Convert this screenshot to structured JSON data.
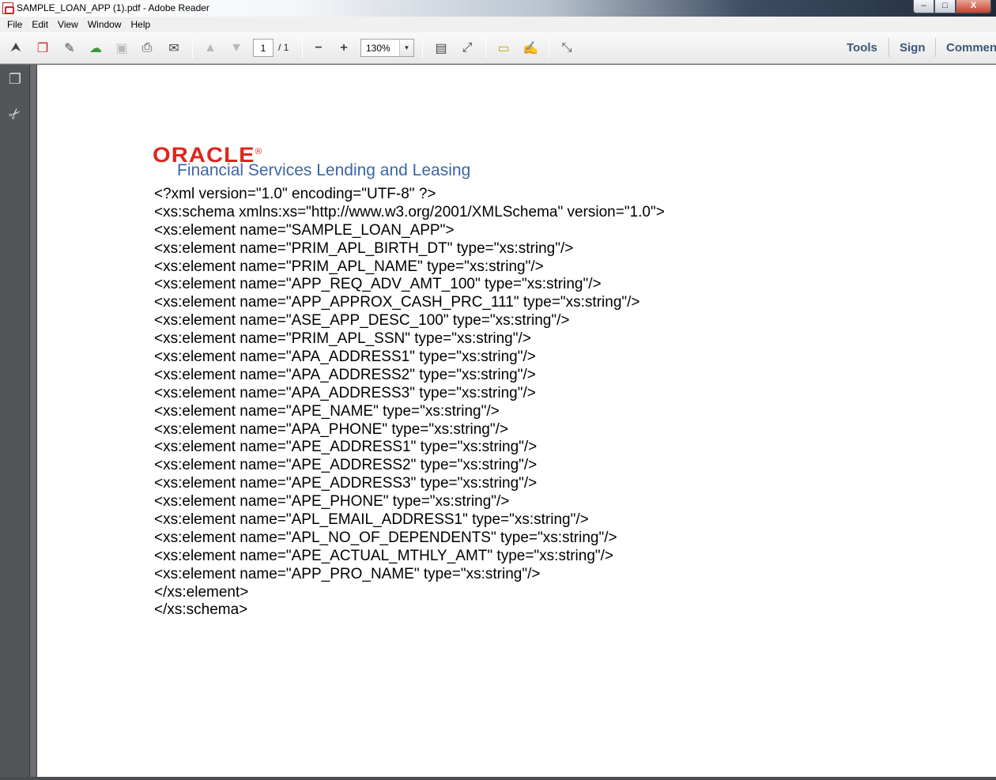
{
  "window": {
    "title": "SAMPLE_LOAN_APP (1).pdf - Adobe Reader",
    "controls": {
      "minimize": "–",
      "maximize": "□",
      "close": "X"
    }
  },
  "menubar": {
    "items": [
      "File",
      "Edit",
      "View",
      "Window",
      "Help"
    ]
  },
  "toolbar": {
    "page_current": "1",
    "page_total": "/ 1",
    "zoom": "130%",
    "zoom_arrow": "▼",
    "icons": {
      "create": "⮝",
      "open": "❐",
      "edit": "✎",
      "upload": "☁",
      "save": "▣",
      "print": "⎙",
      "email": "✉",
      "prev_page": "▲",
      "next_page": "▼",
      "zoom_out": "−",
      "zoom_in": "+",
      "fit_page": "▤",
      "fit_width": "⤢",
      "comment": "▭",
      "highlight": "✍",
      "fullscreen": "⤡"
    }
  },
  "right_tools": {
    "tools": "Tools",
    "sign": "Sign",
    "comment": "Commen"
  },
  "leftnav": {
    "pages_icon": "❐",
    "attachments_icon": "✂"
  },
  "document": {
    "logo_oracle": "ORACLE",
    "logo_mark": "®",
    "logo_subtitle": "Financial Services Lending and Leasing",
    "lines": [
      "<?xml version=\"1.0\" encoding=\"UTF-8\" ?>",
      "<xs:schema xmlns:xs=\"http://www.w3.org/2001/XMLSchema\" version=\"1.0\">",
      "<xs:element name=\"SAMPLE_LOAN_APP\">",
      "<xs:element name=\"PRIM_APL_BIRTH_DT\" type=\"xs:string\"/>",
      "<xs:element name=\"PRIM_APL_NAME\" type=\"xs:string\"/>",
      "<xs:element name=\"APP_REQ_ADV_AMT_100\" type=\"xs:string\"/>",
      "<xs:element name=\"APP_APPROX_CASH_PRC_111\" type=\"xs:string\"/>",
      "<xs:element name=\"ASE_APP_DESC_100\" type=\"xs:string\"/>",
      "<xs:element name=\"PRIM_APL_SSN\" type=\"xs:string\"/>",
      "<xs:element name=\"APA_ADDRESS1\" type=\"xs:string\"/>",
      "<xs:element name=\"APA_ADDRESS2\" type=\"xs:string\"/>",
      "<xs:element name=\"APA_ADDRESS3\" type=\"xs:string\"/>",
      "<xs:element name=\"APE_NAME\" type=\"xs:string\"/>",
      "<xs:element name=\"APA_PHONE\" type=\"xs:string\"/>",
      "<xs:element name=\"APE_ADDRESS1\" type=\"xs:string\"/>",
      "<xs:element name=\"APE_ADDRESS2\" type=\"xs:string\"/>",
      "<xs:element name=\"APE_ADDRESS3\" type=\"xs:string\"/>",
      "<xs:element name=\"APE_PHONE\" type=\"xs:string\"/>",
      "<xs:element name=\"APL_EMAIL_ADDRESS1\" type=\"xs:string\"/>",
      "<xs:element name=\"APL_NO_OF_DEPENDENTS\" type=\"xs:string\"/>",
      "<xs:element name=\"APE_ACTUAL_MTHLY_AMT\" type=\"xs:string\"/>",
      "<xs:element name=\"APP_PRO_NAME\" type=\"xs:string\"/>",
      "</xs:element>",
      "</xs:schema>"
    ]
  },
  "colors": {
    "oracle_red": "#e0251b",
    "subtitle_blue": "#3b66a3",
    "tools_blue": "#3b5679"
  }
}
